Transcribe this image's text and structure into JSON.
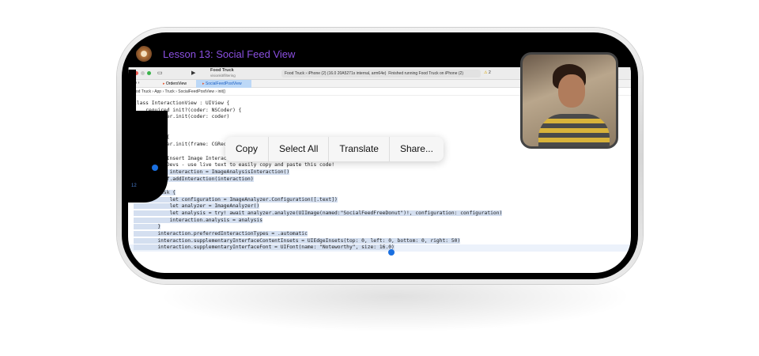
{
  "lesson_title": "Lesson 13: Social Feed View",
  "xcode": {
    "project": "Food Truck",
    "branch": "visionkit/filtering",
    "scheme": "Food Truck",
    "device": "iPhone (2) (16.0 20A5271s internal, arm64e)",
    "status": "Finished running Food Truck on iPhone (2)",
    "warnings": "2",
    "tabs": [
      "OrdersView",
      "SocialFeedPostView"
    ],
    "breadcrumbs": [
      "Food Truck",
      "App",
      "Truck",
      "SocialFeedPostView",
      "init()"
    ]
  },
  "code": [
    "class InteractionView : UIView {",
    "    required init?(coder: NSCoder) {",
    "        super.init(coder: coder)",
    "",
    "",
    "    init() {",
    "        super.init(frame: CGRect.zero)",
    "",
    "        // Insert Image Interaction",
    "        // Devs - use live text to easily copy and paste this code!",
    "        let interaction = ImageAnalysisInteraction()",
    "        self.addInteraction(interaction)",
    "",
    "        Task {",
    "            let configuration = ImageAnalyzer.Configuration([.text])",
    "            let analyzer = ImageAnalyzer()",
    "            let analysis = try! await analyzer.analyze(UIImage(named:\"SocialFeedFreeDonut\")!, configuration: configuration)",
    "            interaction.analysis = analysis",
    "        }",
    "        interaction.preferredInteractionTypes = .automatic",
    "        interaction.supplementaryInterfaceContentInsets = UIEdgeInsets(top: 0, left: 0, bottom: 0, right: 50)",
    "        interaction.supplementaryInterfaceFont = UIFont(name: \"Noteworthy\", size: 16.0)",
    "",
    "}"
  ],
  "line_numbers": {
    "badge": "12"
  },
  "context_menu": [
    "Copy",
    "Select All",
    "Translate",
    "Share..."
  ]
}
